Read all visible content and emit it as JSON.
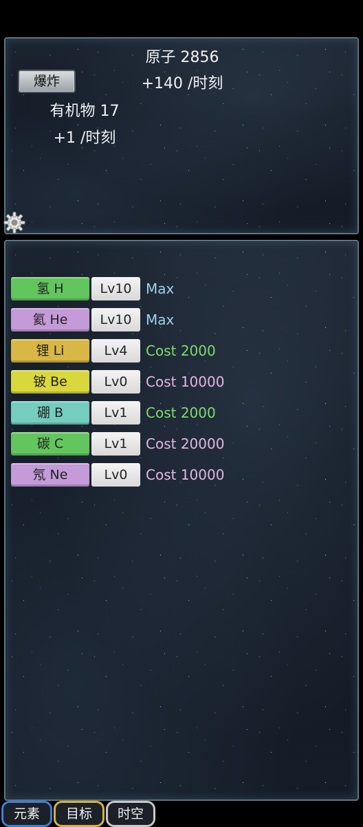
{
  "resources": {
    "atoms_label": "原子 2856",
    "atoms_rate": "+140 /时刻",
    "organics_label": "有机物 17",
    "organics_rate": "+1 /时刻"
  },
  "explode_button": "爆炸",
  "gear_icon": "gear-icon",
  "elements": [
    {
      "name": "氢 H",
      "level": "Lv10",
      "status": "Max",
      "color": "#63c55e",
      "status_color": "#9fd2e8"
    },
    {
      "name": "氦 He",
      "level": "Lv10",
      "status": "Max",
      "color": "#c59ad8",
      "status_color": "#9fd2e8"
    },
    {
      "name": "锂 Li",
      "level": "Lv4",
      "status": "Cost 2000",
      "color": "#d8b744",
      "status_color": "#7fdc6c"
    },
    {
      "name": "铍 Be",
      "level": "Lv0",
      "status": "Cost 10000",
      "color": "#d8d83c",
      "status_color": "#e6b6e6"
    },
    {
      "name": "硼 B",
      "level": "Lv1",
      "status": "Cost 2000",
      "color": "#74cdbf",
      "status_color": "#7fdc6c"
    },
    {
      "name": "碳 C",
      "level": "Lv1",
      "status": "Cost 20000",
      "color": "#63c55e",
      "status_color": "#e6b6e6"
    },
    {
      "name": "氖 Ne",
      "level": "Lv0",
      "status": "Cost 10000",
      "color": "#c59ad8",
      "status_color": "#e6b6e6"
    }
  ],
  "tabs": [
    {
      "label": "元素",
      "border": "#3e7fd6"
    },
    {
      "label": "目标",
      "border": "#d8b33c"
    },
    {
      "label": "时空",
      "border": "#c9c9c9"
    }
  ]
}
